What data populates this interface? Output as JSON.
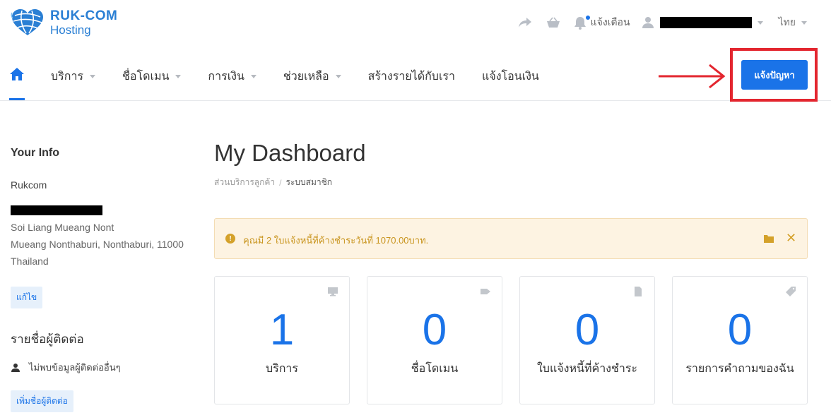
{
  "brand": {
    "name": "RUK-COM",
    "sub": "Hosting"
  },
  "header": {
    "notifications_label": "แจ้งเตือน",
    "language": "ไทย"
  },
  "nav": {
    "items": [
      {
        "label": "บริการ",
        "has_caret": true
      },
      {
        "label": "ชื่อโดเมน",
        "has_caret": true
      },
      {
        "label": "การเงิน",
        "has_caret": true
      },
      {
        "label": "ช่วยเหลือ",
        "has_caret": true
      },
      {
        "label": "สร้างรายได้กับเรา",
        "has_caret": false
      },
      {
        "label": "แจ้งโอนเงิน",
        "has_caret": false
      }
    ],
    "cta_label": "แจ้งปัญหา"
  },
  "sidebar": {
    "title": "Your Info",
    "name": "Rukcom",
    "address_line1": "Soi Liang Mueang Nont",
    "address_line2": "Mueang Nonthaburi, Nonthaburi, 11000",
    "address_line3": "Thailand",
    "edit_label": "แก้ไข",
    "contacts_title": "รายชื่อผู้ติดต่อ",
    "no_contacts_text": "ไม่พบข้อมูลผู้ติดต่ออื่นๆ",
    "add_contact_label": "เพิ่มชื่อผู้ติดต่อ"
  },
  "main": {
    "title": "My Dashboard",
    "breadcrumb": {
      "parent": "ส่วนบริการลูกค้า",
      "separator": "/",
      "current": "ระบบสมาชิก"
    },
    "alert": {
      "text": "คุณมี 2 ใบแจ้งหนี้ที่ค้างชำระวันที่ 1070.00บาท.",
      "close": "✕"
    },
    "cards": [
      {
        "value": "1",
        "label": "บริการ",
        "icon": "monitor-icon"
      },
      {
        "value": "0",
        "label": "ชื่อโดเมน",
        "icon": "tag-icon"
      },
      {
        "value": "0",
        "label": "ใบแจ้งหนี้ที่ค้างชำระ",
        "icon": "document-icon"
      },
      {
        "value": "0",
        "label": "รายการคำถามของฉัน",
        "icon": "ticket-icon"
      }
    ]
  },
  "colors": {
    "accent": "#1a73e8",
    "highlight_frame": "#e3262f",
    "alert_bg": "#fdf3e2",
    "alert_text": "#c9951f"
  }
}
